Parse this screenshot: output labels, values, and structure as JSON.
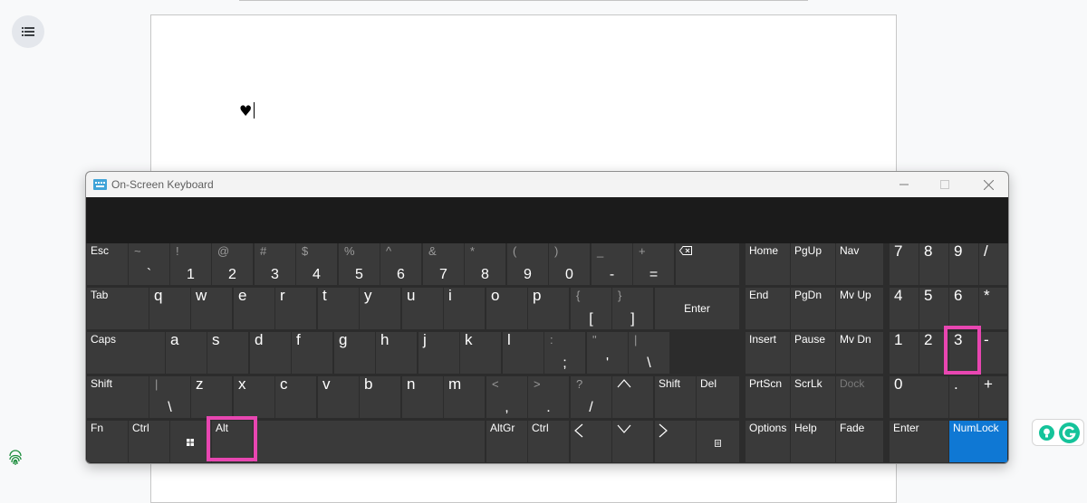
{
  "document": {
    "text": "♥"
  },
  "osk": {
    "title": "On-Screen Keyboard",
    "highlighted_keys": [
      "Alt",
      "3"
    ]
  },
  "keys": {
    "esc": "Esc",
    "r1": [
      {
        "sec": "~",
        "main": "`"
      },
      {
        "sec": "!",
        "main": "1"
      },
      {
        "sec": "@",
        "main": "2"
      },
      {
        "sec": "#",
        "main": "3"
      },
      {
        "sec": "$",
        "main": "4"
      },
      {
        "sec": "%",
        "main": "5"
      },
      {
        "sec": "^",
        "main": "6"
      },
      {
        "sec": "&",
        "main": "7"
      },
      {
        "sec": "*",
        "main": "8"
      },
      {
        "sec": "(",
        "main": "9"
      },
      {
        "sec": ")",
        "main": "0"
      },
      {
        "sec": "_",
        "main": "-"
      },
      {
        "sec": "+",
        "main": "="
      }
    ],
    "tab": "Tab",
    "r2": [
      "q",
      "w",
      "e",
      "r",
      "t",
      "y",
      "u",
      "i",
      "o",
      "p"
    ],
    "r2b": [
      {
        "sec": "{",
        "main": "["
      },
      {
        "sec": "}",
        "main": "]"
      }
    ],
    "enter": "Enter",
    "caps": "Caps",
    "r3": [
      "a",
      "s",
      "d",
      "f",
      "g",
      "h",
      "j",
      "k",
      "l"
    ],
    "r3b": [
      {
        "sec": ":",
        "main": ";"
      },
      {
        "sec": "\"",
        "main": "'"
      },
      {
        "sec": "|",
        "main": "\\"
      }
    ],
    "shift": "Shift",
    "r4a": {
      "sec": "|",
      "main": "\\"
    },
    "r4": [
      "z",
      "x",
      "c",
      "v",
      "b",
      "n",
      "m"
    ],
    "r4b": [
      {
        "sec": "<",
        "main": ","
      },
      {
        "sec": ">",
        "main": "."
      },
      {
        "sec": "?",
        "main": "/"
      }
    ],
    "shift_right": "Shift",
    "del": "Del",
    "fn": "Fn",
    "ctrl": "Ctrl",
    "alt": "Alt",
    "altgr": "AltGr",
    "ctrl_right": "Ctrl",
    "nav": {
      "home": "Home",
      "pgup": "PgUp",
      "navkey": "Nav",
      "end": "End",
      "pgdn": "PgDn",
      "mvup": "Mv Up",
      "insert": "Insert",
      "pause": "Pause",
      "mvdn": "Mv Dn",
      "prtscn": "PrtScn",
      "scrlk": "ScrLk",
      "dock": "Dock",
      "options": "Options",
      "help": "Help",
      "fade": "Fade"
    },
    "num": {
      "n7": "7",
      "n8": "8",
      "n9": "9",
      "div": "/",
      "n4": "4",
      "n5": "5",
      "n6": "6",
      "mul": "*",
      "n1": "1",
      "n2": "2",
      "n3": "3",
      "sub": "-",
      "n0": "0",
      "dot": ".",
      "add": "+",
      "enter": "Enter",
      "numlock": "NumLock"
    }
  },
  "colors": {
    "highlight": "#e846b1",
    "numlock_active": "#0f78d4",
    "key_bg": "#3a3a3a"
  }
}
